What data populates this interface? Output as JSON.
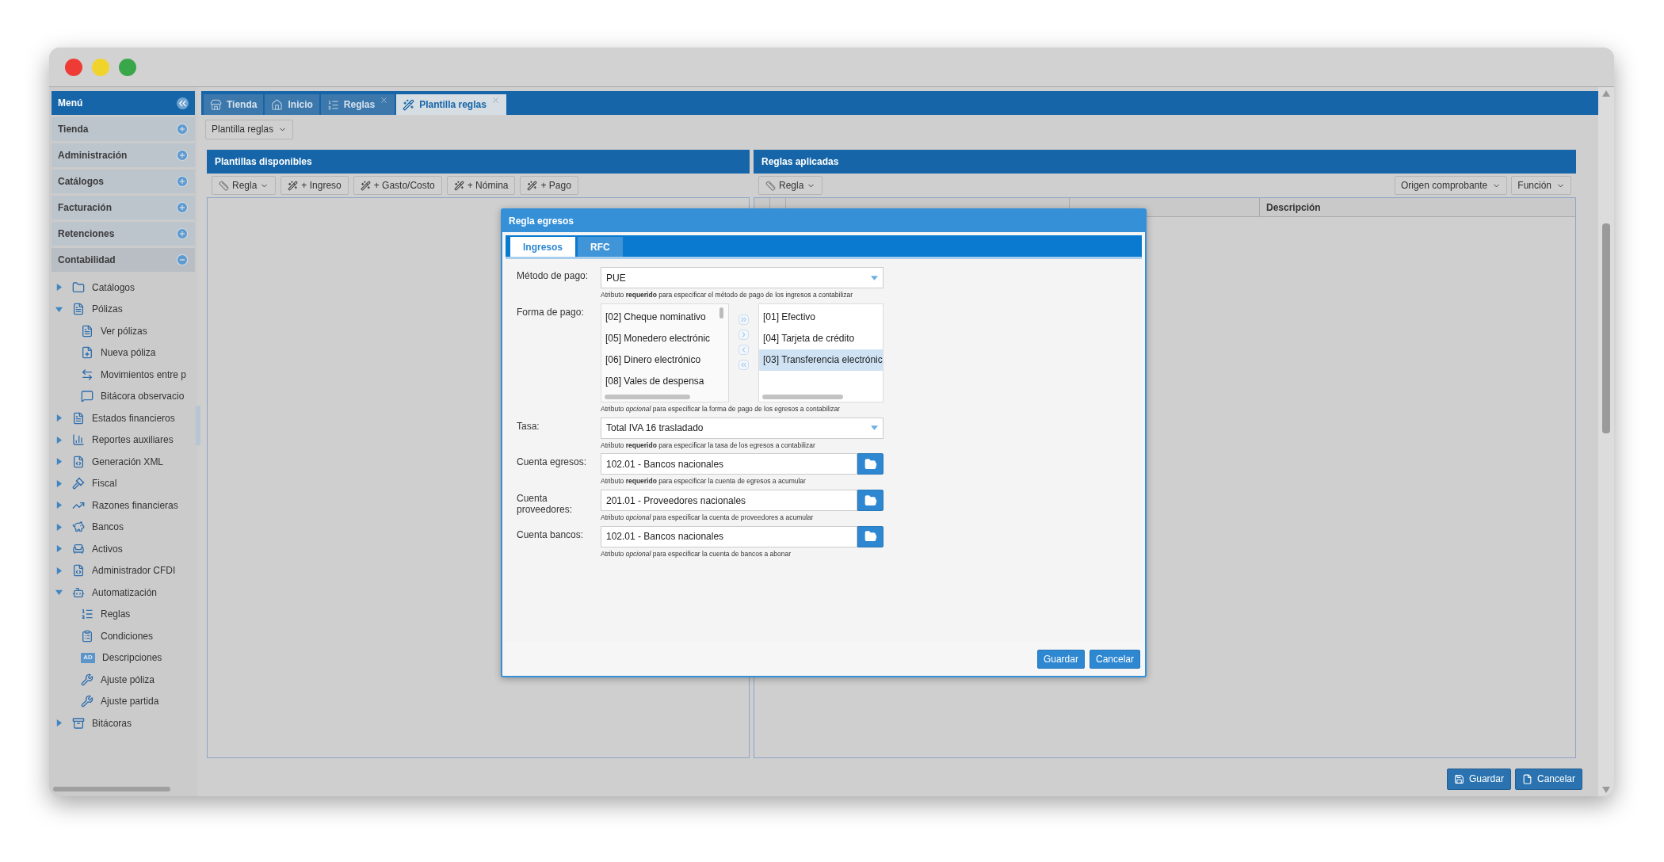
{
  "sidebar": {
    "title": "Menú",
    "sections": [
      {
        "label": "Tienda",
        "expanded": false
      },
      {
        "label": "Administración",
        "expanded": false
      },
      {
        "label": "Catálogos",
        "expanded": false
      },
      {
        "label": "Facturación",
        "expanded": false
      },
      {
        "label": "Retenciones",
        "expanded": false
      },
      {
        "label": "Contabilidad",
        "expanded": true
      }
    ],
    "tree": [
      {
        "label": "Catálogos",
        "expanded": false
      },
      {
        "label": "Pólizas",
        "expanded": true,
        "children": [
          {
            "label": "Ver pólizas"
          },
          {
            "label": "Nueva póliza"
          },
          {
            "label": "Movimientos entre p"
          },
          {
            "label": "Bitácora observacio"
          }
        ]
      },
      {
        "label": "Estados financieros",
        "expanded": false
      },
      {
        "label": "Reportes auxiliares",
        "expanded": false
      },
      {
        "label": "Generación XML",
        "expanded": false
      },
      {
        "label": "Fiscal",
        "expanded": false
      },
      {
        "label": "Razones financieras",
        "expanded": false
      },
      {
        "label": "Bancos",
        "expanded": false
      },
      {
        "label": "Activos",
        "expanded": false
      },
      {
        "label": "Administrador CFDI",
        "expanded": false
      },
      {
        "label": "Automatización",
        "expanded": true,
        "children": [
          {
            "label": "Reglas"
          },
          {
            "label": "Condiciones"
          },
          {
            "label": "Descripciones",
            "badge": "AD"
          },
          {
            "label": "Ajuste póliza"
          },
          {
            "label": "Ajuste partida"
          }
        ]
      },
      {
        "label": "Bitácoras",
        "expanded": false
      }
    ]
  },
  "tabs": [
    {
      "label": "Tienda",
      "selected": false,
      "closable": false
    },
    {
      "label": "Inicio",
      "selected": false,
      "closable": false
    },
    {
      "label": "Reglas",
      "selected": false,
      "closable": true
    },
    {
      "label": "Plantilla reglas",
      "selected": true,
      "closable": true
    }
  ],
  "toolbar": {
    "menu": "Plantilla reglas"
  },
  "left_panel": {
    "title": "Plantillas disponibles",
    "buttons": [
      {
        "label": "Regla",
        "kind": "dropdown"
      },
      {
        "label": "+ Ingreso",
        "kind": "wand"
      },
      {
        "label": "+ Gasto/Costo",
        "kind": "wand"
      },
      {
        "label": "+ Nómina",
        "kind": "wand"
      },
      {
        "label": "+ Pago",
        "kind": "wand"
      }
    ]
  },
  "right_panel": {
    "title": "Reglas aplicadas",
    "buttons": [
      {
        "label": "Regla",
        "kind": "dropdown"
      }
    ],
    "filters": [
      "Origen comprobante",
      "Función"
    ],
    "columns": [
      "Descripción"
    ]
  },
  "dialog": {
    "title": "Regla egresos",
    "tabs": [
      {
        "label": "Ingresos",
        "selected": true
      },
      {
        "label": "RFC",
        "selected": false
      }
    ],
    "fields": [
      {
        "kind": "select",
        "label": "Método de pago:",
        "value": "PUE",
        "help": "Atributo **requerido** para especificar el método de pago de los ingresos a contabilizar"
      },
      {
        "kind": "duallist",
        "label": "Forma de pago:",
        "available": [
          "[02] Cheque nominativo",
          "[05] Monedero electrónic",
          "[06] Dinero electrónico",
          "[08] Vales de despensa"
        ],
        "chosen": [
          {
            "label": "[01] Efectivo",
            "selected": false
          },
          {
            "label": "[04] Tarjeta de crédito",
            "selected": false
          },
          {
            "label": "[03] Transferencia electrónic",
            "selected": true
          }
        ],
        "help": "Atributo *opcional* para especificar la forma de pago de los egresos a contabilizar"
      },
      {
        "kind": "select",
        "label": "Tasa:",
        "value": "Total IVA 16 trasladado",
        "help": "Atributo **requerido** para especificar la tasa de los egresos a contabilizar"
      },
      {
        "kind": "lookup",
        "label": "Cuenta egresos:",
        "value": "102.01 - Bancos nacionales",
        "help": "Atributo **requerido** para especificar la cuenta de egresos a acumular"
      },
      {
        "kind": "lookup",
        "label": "Cuenta proveedores:",
        "value": "201.01 - Proveedores nacionales",
        "help": "Atributo *opcional* para especificar la cuenta de proveedores a acumular"
      },
      {
        "kind": "lookup",
        "label": "Cuenta bancos:",
        "value": "102.01 - Bancos nacionales",
        "help": "Atributo *opcional* para especificar la cuenta de bancos a abonar"
      }
    ],
    "buttons": [
      "Guardar",
      "Cancelar"
    ]
  },
  "footer": {
    "buttons": [
      {
        "label": "Guardar",
        "kind": "save"
      },
      {
        "label": "Cancelar",
        "kind": "cancel"
      }
    ]
  }
}
